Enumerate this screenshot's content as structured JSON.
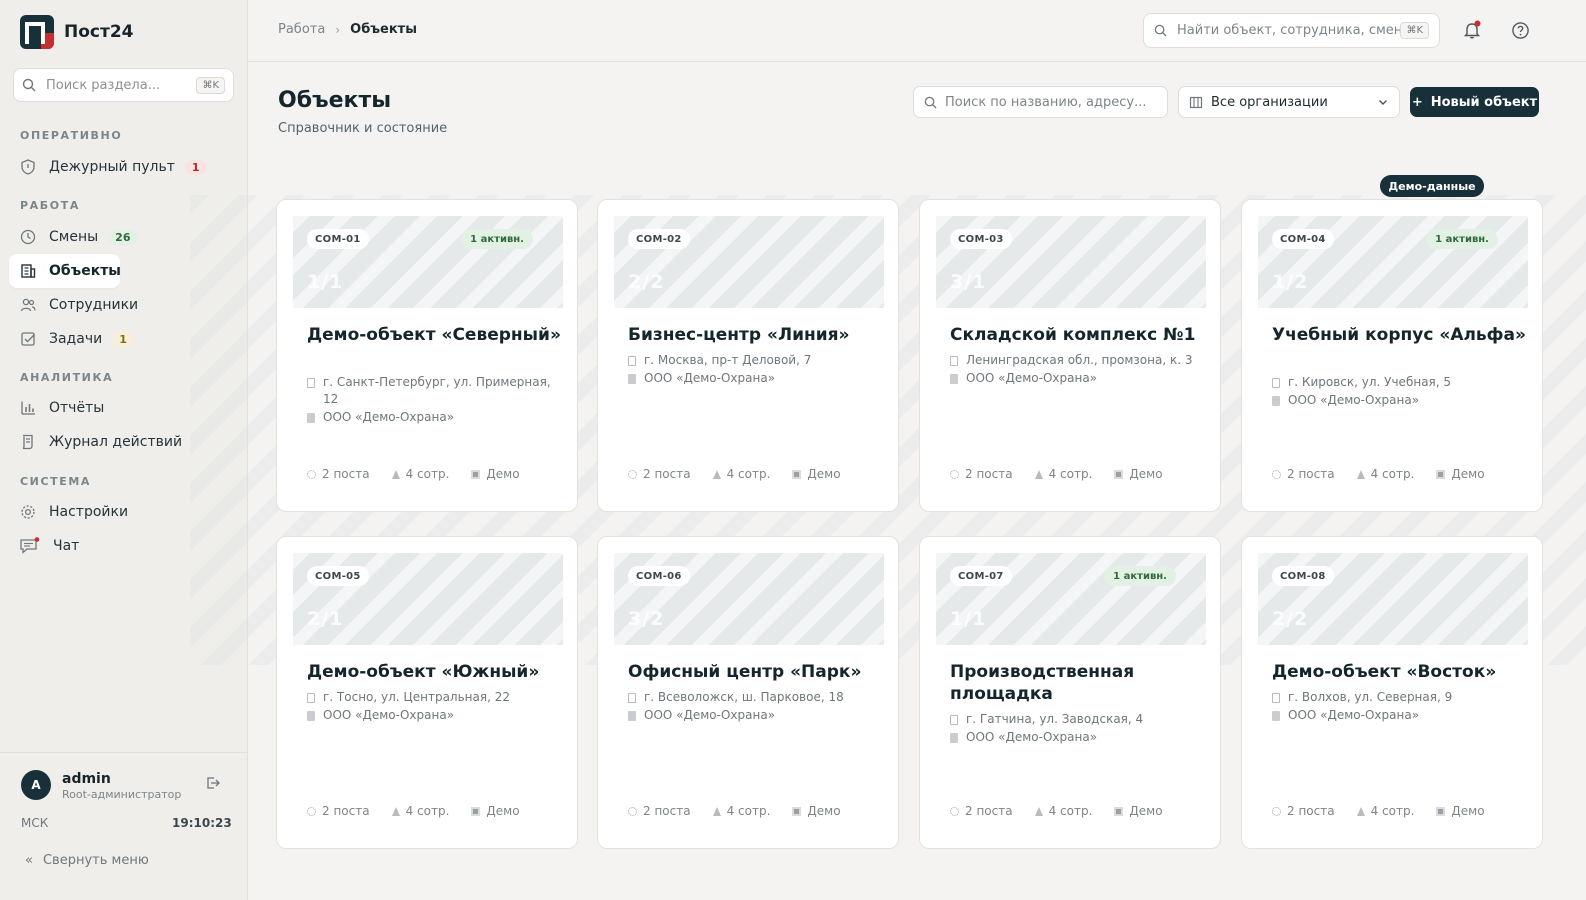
{
  "app": {
    "name": "Пост24"
  },
  "sidebar": {
    "search_placeholder": "Поиск раздела...",
    "search_shortcut": "⌘K",
    "sections": {
      "operational": "ОПЕРАТИВНО",
      "work": "РАБОТА",
      "analytics": "АНАЛИТИКА",
      "system": "СИСТЕМА"
    },
    "items": [
      {
        "label": "Дежурный пульт",
        "badge": "1",
        "icon": "shield-icon"
      },
      {
        "label": "Смены",
        "badge": "26",
        "icon": "clock-icon"
      },
      {
        "label": "Объекты",
        "badge": "",
        "icon": "building-icon",
        "active": true
      },
      {
        "label": "Сотрудники",
        "badge": "",
        "icon": "users-icon"
      },
      {
        "label": "Задачи",
        "badge": "1",
        "icon": "checkbox-icon"
      },
      {
        "label": "Отчёты",
        "badge": "",
        "icon": "bar-chart-icon"
      },
      {
        "label": "Журнал действий",
        "badge": "",
        "icon": "log-icon"
      },
      {
        "label": "Настройки",
        "badge": "",
        "icon": "gear-icon"
      },
      {
        "label": "Чат",
        "badge": "",
        "icon": "chat-icon"
      }
    ],
    "user": {
      "initial": "A",
      "name": "admin",
      "role": "Root-администратор"
    },
    "timezone": "МСК",
    "time": "19:10:23",
    "collapse_label": "Свернуть меню"
  },
  "topbar": {
    "breadcrumb": [
      "Работа",
      "Объекты"
    ],
    "search_placeholder": "Найти объект, сотрудника, смену",
    "search_shortcut": "⌘K"
  },
  "page": {
    "title": "Объекты",
    "subtitle": "Справочник и состояние",
    "filter_placeholder": "Поиск по названию, адресу...",
    "org_select": "Все организации",
    "new_button": "Новый объект",
    "demo_badge": "Демо-данные"
  },
  "objects": [
    {
      "code": "COM-01",
      "active": "1 активн.",
      "ratio": "1/1",
      "title": "Демо-объект «Северный»",
      "address": "г. Санкт-Петербург, ул. Примерная, 12",
      "org": "ООО «Демо-Охрана»",
      "posts": "2 поста",
      "staff": "4 сотр.",
      "tag": "Демо"
    },
    {
      "code": "COM-02",
      "active": "",
      "ratio": "2/2",
      "title": "Бизнес-центр «Линия»",
      "address": "г. Москва, пр-т Деловой, 7",
      "org": "ООО «Демо-Охрана»",
      "posts": "2 поста",
      "staff": "4 сотр.",
      "tag": "Демо"
    },
    {
      "code": "COM-03",
      "active": "",
      "ratio": "3/1",
      "title": "Складской комплекс №1",
      "address": "Ленинградская обл., промзона, к. 3",
      "org": "ООО «Демо-Охрана»",
      "posts": "2 поста",
      "staff": "4 сотр.",
      "tag": "Демо"
    },
    {
      "code": "COM-04",
      "active": "1 активн.",
      "ratio": "1/2",
      "title": "Учебный корпус «Альфа»",
      "address": "г. Кировск, ул. Учебная, 5",
      "org": "ООО «Демо-Охрана»",
      "posts": "2 поста",
      "staff": "4 сотр.",
      "tag": "Демо"
    },
    {
      "code": "COM-05",
      "active": "",
      "ratio": "2/1",
      "title": "Демо-объект «Южный»",
      "address": "г. Тосно, ул. Центральная, 22",
      "org": "ООО «Демо-Охрана»",
      "posts": "2 поста",
      "staff": "4 сотр.",
      "tag": "Демо"
    },
    {
      "code": "COM-06",
      "active": "",
      "ratio": "3/2",
      "title": "Офисный центр «Парк»",
      "address": "г. Всеволожск, ш. Парковое, 18",
      "org": "ООО «Демо-Охрана»",
      "posts": "2 поста",
      "staff": "4 сотр.",
      "tag": "Демо"
    },
    {
      "code": "COM-07",
      "active": "1 активн.",
      "ratio": "1/1",
      "title": "Производственная площадка",
      "address": "г. Гатчина, ул. Заводская, 4",
      "org": "ООО «Демо-Охрана»",
      "posts": "2 поста",
      "staff": "4 сотр.",
      "tag": "Демо"
    },
    {
      "code": "COM-08",
      "active": "",
      "ratio": "2/2",
      "title": "Демо-объект «Восток»",
      "address": "г. Волхов, ул. Северная, 9",
      "org": "ООО «Демо-Охрана»",
      "posts": "2 поста",
      "staff": "4 сотр.",
      "tag": "Демо"
    }
  ],
  "colors": {
    "brand_dark": "#17303a",
    "brand_red": "#c62f2f",
    "active_green": "#2f6a3c",
    "background": "#f4f3f1"
  }
}
